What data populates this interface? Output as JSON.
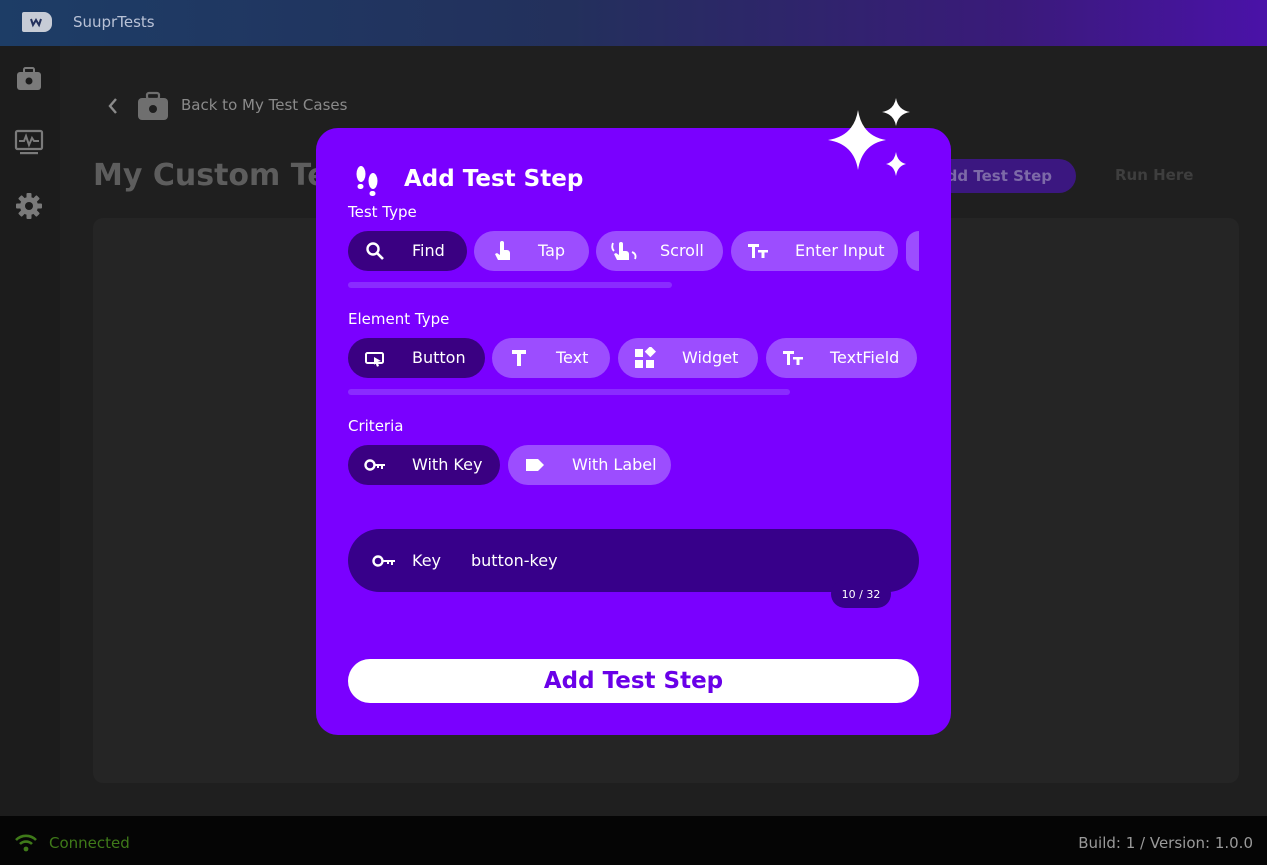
{
  "app": {
    "title": "SuuprTests"
  },
  "nav": {
    "items": [
      "suitcase-icon",
      "monitor-icon",
      "gear-icon"
    ]
  },
  "header": {
    "back_label": "Back to My Test Cases",
    "page_title": "My Custom Test",
    "add_step_label": "Add Test Step",
    "run_label": "Run Here"
  },
  "modal": {
    "title": "Add Test Step",
    "test_type": {
      "label": "Test Type",
      "options": [
        "Find",
        "Tap",
        "Scroll",
        "Enter Input"
      ],
      "selected": "Find"
    },
    "element_type": {
      "label": "Element Type",
      "options": [
        "Button",
        "Text",
        "Widget",
        "TextField"
      ],
      "selected": "Button"
    },
    "criteria": {
      "label": "Criteria",
      "options": [
        "With Key",
        "With Label"
      ],
      "selected": "With Key"
    },
    "key_field": {
      "label": "Key",
      "value": "button-key",
      "counter": "10 / 32"
    },
    "submit_label": "Add Test Step"
  },
  "status": {
    "connection": "Connected",
    "version": "Build: 1 / Version: 1.0.0"
  },
  "colors": {
    "modal_bg": "#7a00ff",
    "chip_bg": "#9c4dff",
    "chip_selected_bg": "#3a0082",
    "connected": "#3f7a19"
  }
}
